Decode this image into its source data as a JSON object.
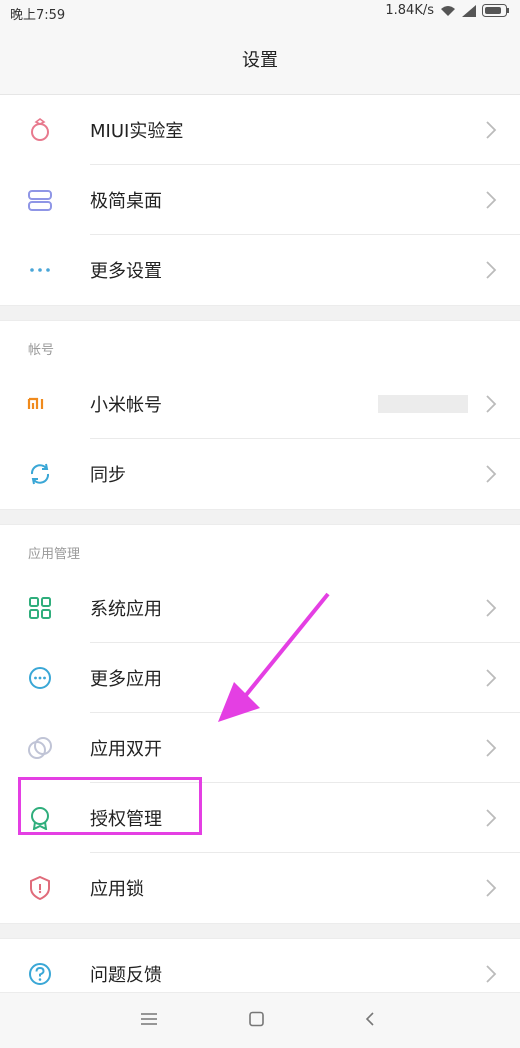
{
  "status": {
    "time": "晚上7:59",
    "speed": "1.84K/s"
  },
  "page": {
    "title": "设置"
  },
  "groups": {
    "top": [
      {
        "label": "MIUI实验室"
      },
      {
        "label": "极简桌面"
      },
      {
        "label": "更多设置"
      }
    ],
    "account": {
      "header": "帐号",
      "items": [
        {
          "label": "小米帐号"
        },
        {
          "label": "同步"
        }
      ]
    },
    "apps": {
      "header": "应用管理",
      "items": [
        {
          "label": "系统应用"
        },
        {
          "label": "更多应用"
        },
        {
          "label": "应用双开"
        },
        {
          "label": "授权管理"
        },
        {
          "label": "应用锁"
        }
      ]
    },
    "bottom": [
      {
        "label": "问题反馈"
      }
    ]
  },
  "colors": {
    "highlight": "#e43fe3",
    "arrow": "#e43fe3"
  },
  "icons": {
    "miui-lab": "ring-icon",
    "simple-desktop": "layout-icon",
    "more-settings": "dots-icon",
    "mi-account": "mi-logo-icon",
    "sync": "sync-icon",
    "system-apps": "grid-icon",
    "more-apps": "more-circle-icon",
    "dual-apps": "dual-circle-icon",
    "permissions": "badge-icon",
    "app-lock": "shield-icon",
    "feedback": "question-icon"
  }
}
